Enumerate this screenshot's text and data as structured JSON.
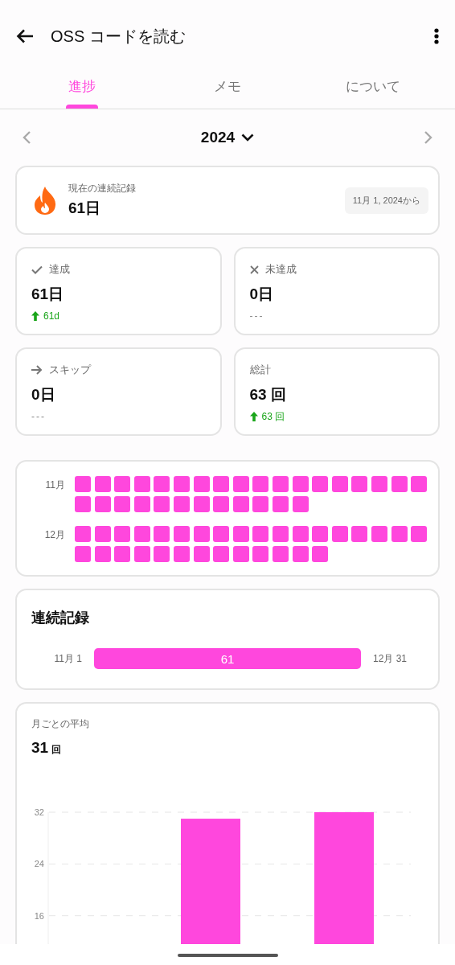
{
  "header": {
    "title": "OSS コードを読む"
  },
  "tabs": [
    {
      "label": "進捗",
      "selected": true
    },
    {
      "label": "メモ",
      "selected": false
    },
    {
      "label": "について",
      "selected": false
    }
  ],
  "year_nav": {
    "year": "2024"
  },
  "current_streak": {
    "label": "現在の連続記録",
    "value": "61日",
    "since": "11月 1, 2024から"
  },
  "stats": [
    {
      "kind": "check",
      "label": "達成",
      "value": "61日",
      "trend": {
        "kind": "up",
        "text": "61d"
      }
    },
    {
      "kind": "cross",
      "label": "未達成",
      "value": "0日",
      "trend": {
        "kind": "none",
        "text": "---"
      }
    },
    {
      "kind": "arrow",
      "label": "スキップ",
      "value": "0日",
      "trend": {
        "kind": "none",
        "text": "---"
      }
    },
    {
      "kind": "plain",
      "label": "総計",
      "value": "63 回",
      "trend": {
        "kind": "up",
        "text": "63 回"
      }
    }
  ],
  "calendar": [
    {
      "month": "11月",
      "days": [
        {
          "done": true
        },
        {
          "done": true
        },
        {
          "done": true
        },
        {
          "done": true
        },
        {
          "done": true
        },
        {
          "done": true
        },
        {
          "done": true
        },
        {
          "done": true
        },
        {
          "done": true
        },
        {
          "done": true
        },
        {
          "done": true
        },
        {
          "done": true
        },
        {
          "done": true
        },
        {
          "done": true
        },
        {
          "done": true
        },
        {
          "done": true
        },
        {
          "done": true
        },
        {
          "done": true
        },
        {
          "done": true
        },
        {
          "done": true
        },
        {
          "done": true
        },
        {
          "done": true
        },
        {
          "done": true
        },
        {
          "done": true
        },
        {
          "done": true
        },
        {
          "done": true
        },
        {
          "done": true
        },
        {
          "done": true
        },
        {
          "done": true
        },
        {
          "done": true
        }
      ]
    },
    {
      "month": "12月",
      "days": [
        {
          "done": true
        },
        {
          "done": true
        },
        {
          "done": true
        },
        {
          "done": true
        },
        {
          "done": true
        },
        {
          "done": true
        },
        {
          "done": true
        },
        {
          "done": true
        },
        {
          "done": true
        },
        {
          "done": true
        },
        {
          "done": true
        },
        {
          "done": true
        },
        {
          "done": true
        },
        {
          "done": true
        },
        {
          "done": true
        },
        {
          "done": true
        },
        {
          "done": true
        },
        {
          "done": true
        },
        {
          "done": true
        },
        {
          "done": true
        },
        {
          "done": true
        },
        {
          "done": true
        },
        {
          "done": true
        },
        {
          "done": true
        },
        {
          "done": true
        },
        {
          "done": true
        },
        {
          "done": true
        },
        {
          "done": true
        },
        {
          "done": true
        },
        {
          "done": true
        },
        {
          "done": true
        }
      ]
    }
  ],
  "streaks": {
    "title": "連続記録",
    "items": [
      {
        "start": "11月 1",
        "length": "61",
        "end": "12月 31"
      }
    ]
  },
  "monthly_average": {
    "label": "月ごとの平均",
    "value": "31",
    "unit": "回",
    "chart_data": {
      "type": "bar",
      "values": [
        null,
        31,
        32
      ],
      "ylim": [
        10,
        32
      ],
      "yticks": [
        16,
        24,
        32
      ]
    }
  }
}
